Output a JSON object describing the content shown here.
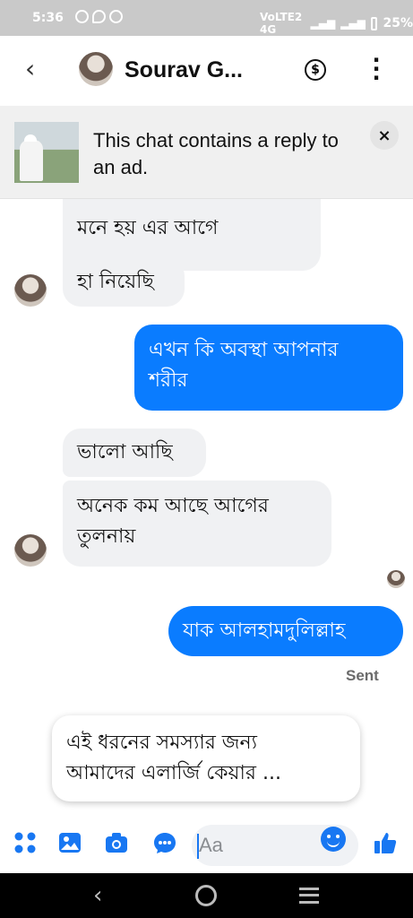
{
  "status_bar": {
    "time": "5:36",
    "network": "VoLTE2 4G",
    "battery": "25%"
  },
  "header": {
    "contact_name": "Sourav G...",
    "back_icon": "chevron-left-icon",
    "payment_icon": "dollar-circle-icon",
    "more_icon": "more-vertical-icon"
  },
  "ad_banner": {
    "text": "This chat contains a reply to an ad.",
    "close": "×"
  },
  "messages": [
    {
      "direction": "incoming",
      "text": "মনে হয় এর আগে",
      "partial": true
    },
    {
      "direction": "incoming",
      "text": "হা নিয়েছি"
    },
    {
      "direction": "outgoing",
      "text_line1": "এখন কি অবস্থা আপনার",
      "text_line2": "শরীর"
    },
    {
      "direction": "incoming",
      "text": "ভালো আছি"
    },
    {
      "direction": "incoming",
      "text_line1": "অনেক কম আছে আগের",
      "text_line2": "তুলনায়"
    },
    {
      "direction": "outgoing",
      "text": "যাক আলহামদুলিল্লাহ"
    },
    {
      "direction": "draft",
      "text_line1": "এই ধরনের সমস্যার জন্য",
      "text_line2": "আমাদের এলার্জি কেয়ার ..."
    }
  ],
  "sent_status": "Sent",
  "composer": {
    "placeholder": "Aa",
    "icons": [
      "apps-icon",
      "image-icon",
      "camera-icon",
      "chat-icon",
      "emoji-icon",
      "like-icon"
    ]
  },
  "colors": {
    "outgoing_bubble": "#0a7cff",
    "incoming_bubble": "#f0f1f3",
    "accent": "#1877f2"
  }
}
